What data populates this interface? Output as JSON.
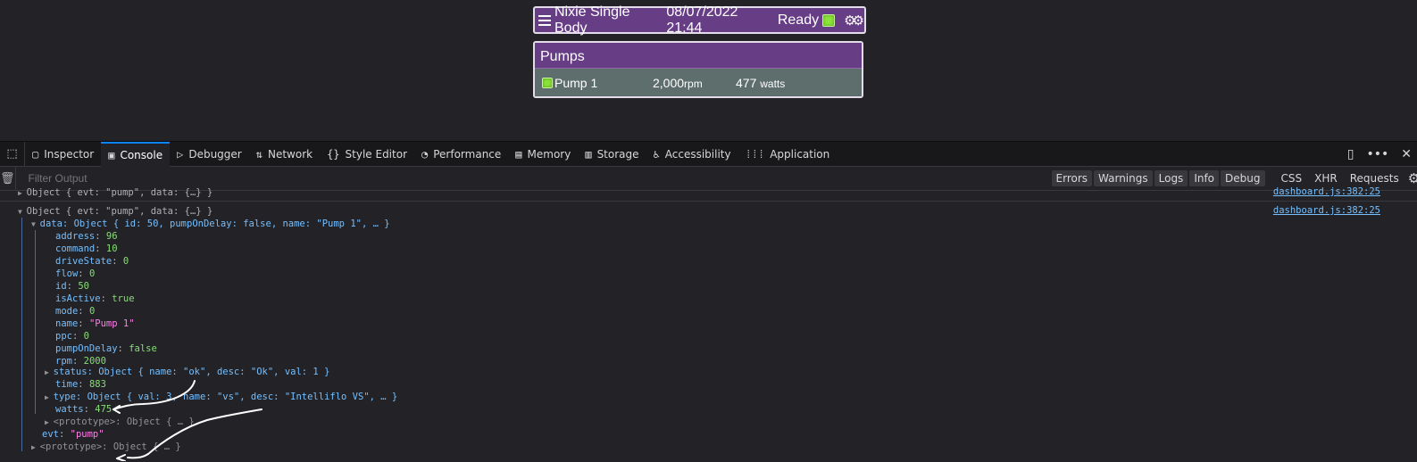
{
  "app": {
    "menu_icon": "hamburger-icon",
    "title": "Nixie Single Body",
    "datetime": "08/07/2022 21:44",
    "status": "Ready",
    "status_led_color": "#8ce23b",
    "settings_icon": "gears-icon",
    "accent_color": "#673d86"
  },
  "pumps": {
    "title": "Pumps",
    "rows": [
      {
        "name": "Pump 1",
        "rpm": "2,000",
        "rpm_unit": "rpm",
        "watts": "477",
        "watts_unit": "watts"
      }
    ]
  },
  "devtools": {
    "tabs": [
      {
        "label": "Inspector",
        "icon": "inspector-icon"
      },
      {
        "label": "Console",
        "icon": "console-icon",
        "active": true
      },
      {
        "label": "Debugger",
        "icon": "debugger-icon"
      },
      {
        "label": "Network",
        "icon": "network-icon"
      },
      {
        "label": "Style Editor",
        "icon": "style-editor-icon"
      },
      {
        "label": "Performance",
        "icon": "performance-icon"
      },
      {
        "label": "Memory",
        "icon": "memory-icon"
      },
      {
        "label": "Storage",
        "icon": "storage-icon"
      },
      {
        "label": "Accessibility",
        "icon": "accessibility-icon"
      },
      {
        "label": "Application",
        "icon": "application-icon"
      }
    ],
    "filter_placeholder": "Filter Output",
    "levels": [
      "Errors",
      "Warnings",
      "Logs",
      "Info",
      "Debug"
    ],
    "other_filters": [
      "CSS",
      "XHR",
      "Requests"
    ],
    "console": {
      "prev_entry": "Object { evt: \"pump\", data: {…} }",
      "source": "dashboard.js:382:25",
      "entry_summary": "Object { evt: \"pump\", data: {…} }",
      "data_summary": "data: Object { id: 50, pumpOnDelay: false, name: \"Pump 1\", … }",
      "props": [
        {
          "key": "address",
          "value": "96",
          "type": "num"
        },
        {
          "key": "command",
          "value": "10",
          "type": "num"
        },
        {
          "key": "driveState",
          "value": "0",
          "type": "num"
        },
        {
          "key": "flow",
          "value": "0",
          "type": "num"
        },
        {
          "key": "id",
          "value": "50",
          "type": "num"
        },
        {
          "key": "isActive",
          "value": "true",
          "type": "bool"
        },
        {
          "key": "mode",
          "value": "0",
          "type": "num"
        },
        {
          "key": "name",
          "value": "\"Pump 1\"",
          "type": "str"
        },
        {
          "key": "ppc",
          "value": "0",
          "type": "num"
        },
        {
          "key": "pumpOnDelay",
          "value": "false",
          "type": "bool"
        },
        {
          "key": "rpm",
          "value": "2000",
          "type": "num"
        }
      ],
      "status_line": "status: Object { name: \"ok\", desc: \"Ok\", val: 1 }",
      "time_line": {
        "key": "time",
        "value": "883"
      },
      "type_line": "type: Object { val: 3, name: \"vs\", desc: \"Intelliflo VS\", … }",
      "watts_line": {
        "key": "watts",
        "value": "475"
      },
      "proto_inner": "<prototype>: Object { … }",
      "evt_line": {
        "key": "evt",
        "value": "\"pump\""
      },
      "proto_outer": "<prototype>: Object { … }"
    }
  }
}
